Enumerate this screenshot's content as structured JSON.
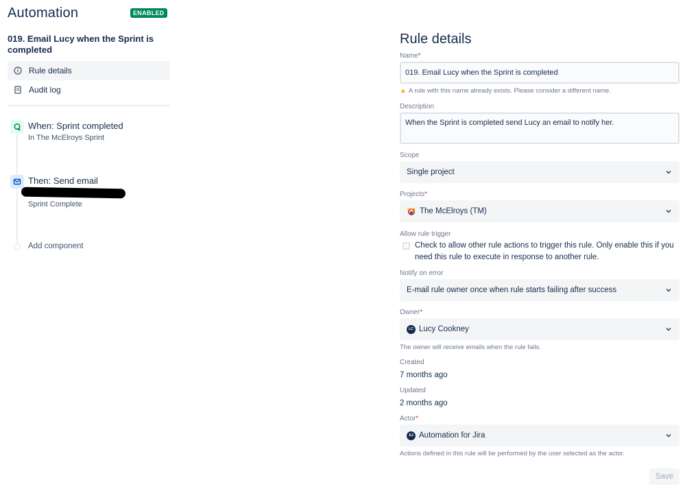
{
  "app": {
    "title": "Automation",
    "status_badge": "ENABLED",
    "rule_name": "019. Email Lucy when the Sprint is completed"
  },
  "sidebar": {
    "nav": [
      {
        "label": "Rule details",
        "icon": "info-icon",
        "active": true
      },
      {
        "label": "Audit log",
        "icon": "document-icon",
        "active": false
      }
    ],
    "flow": {
      "trigger": {
        "title": "When: Sprint completed",
        "subtitle": "In The McElroys Sprint",
        "icon": "trigger-icon"
      },
      "action": {
        "title": "Then: Send email",
        "subtitle": "Sprint Complete",
        "icon": "email-icon"
      },
      "add_component": "Add component"
    }
  },
  "details": {
    "title": "Rule details",
    "name": {
      "label": "Name",
      "required": "*",
      "value": "019. Email Lucy when the Sprint is completed",
      "warning": "A rule with this name already exists. Please consider a different name."
    },
    "description": {
      "label": "Description",
      "value": "When the Sprint is completed send Lucy an email to notify her."
    },
    "scope": {
      "label": "Scope",
      "value": "Single project"
    },
    "projects": {
      "label": "Projects",
      "required": "*",
      "value": "The McElroys (TM)"
    },
    "allow_trigger": {
      "label": "Allow rule trigger",
      "checked": false,
      "text": "Check to allow other rule actions to trigger this rule. Only enable this if you need this rule to execute in response to another rule."
    },
    "notify_on_error": {
      "label": "Notify on error",
      "value": "E-mail rule owner once when rule starts failing after success"
    },
    "owner": {
      "label": "Owner",
      "required": "*",
      "value": "Lucy Cookney",
      "avatar_initials": "LC",
      "help": "The owner will receive emails when the rule fails."
    },
    "created": {
      "label": "Created",
      "value": "7 months ago"
    },
    "updated": {
      "label": "Updated",
      "value": "2 months ago"
    },
    "actor": {
      "label": "Actor",
      "required": "*",
      "value": "Automation for Jira",
      "avatar_initials": "AJ",
      "help": "Actions defined in this rule will be performed by the user selected as the actor."
    },
    "save_label": "Save"
  },
  "colors": {
    "badge_green": "#00875a",
    "required_red": "#de350b",
    "warning_yellow": "#ffab00",
    "text_primary": "#172b4d"
  }
}
